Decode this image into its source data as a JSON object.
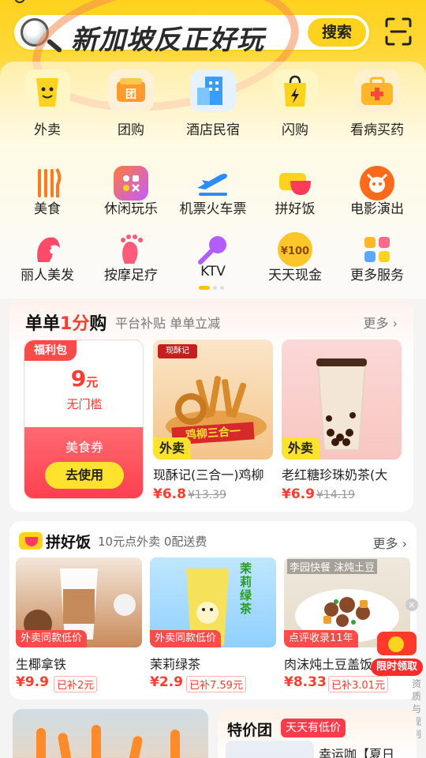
{
  "search": {
    "query": "新加坡反正好玩",
    "button_label": "搜索"
  },
  "categories": [
    {
      "label": "外卖",
      "icon": "takeout-icon"
    },
    {
      "label": "团购",
      "icon": "group-buy-icon"
    },
    {
      "label": "酒店民宿",
      "icon": "hotel-icon"
    },
    {
      "label": "闪购",
      "icon": "flash-buy-icon"
    },
    {
      "label": "看病买药",
      "icon": "medicine-icon"
    },
    {
      "label": "美食",
      "icon": "food-icon"
    },
    {
      "label": "休闲玩乐",
      "icon": "leisure-icon"
    },
    {
      "label": "机票火车票",
      "icon": "plane-icon"
    },
    {
      "label": "拼好饭",
      "icon": "pinhaofan-icon"
    },
    {
      "label": "电影演出",
      "icon": "movie-icon"
    },
    {
      "label": "丽人美发",
      "icon": "beauty-icon"
    },
    {
      "label": "按摩足疗",
      "icon": "massage-icon"
    },
    {
      "label": "KTV",
      "icon": "ktv-icon"
    },
    {
      "label": "天天现金",
      "icon": "cash-icon"
    },
    {
      "label": "更多服务",
      "icon": "more-services-icon"
    }
  ],
  "deals": {
    "title_prefix": "单单",
    "title_highlight": "1分",
    "title_suffix": "购",
    "subtitle": "平台补贴 单单立减",
    "more": "更多",
    "coupon": {
      "tag": "福利包",
      "value": "9",
      "unit": "元",
      "condition": "无门槛",
      "name": "美食券",
      "button": "去使用"
    },
    "products": [
      {
        "badge": "外卖",
        "name": "现酥记(三合一)鸡柳",
        "price": "¥6.8",
        "original": "¥13.39",
        "brand": "现酥记",
        "banner": "鸡柳三合一"
      },
      {
        "badge": "外卖",
        "name": "老红糖珍珠奶茶(大",
        "price": "¥6.9",
        "original": "¥14.19"
      }
    ]
  },
  "pinhaofan": {
    "title": "拼好饭",
    "subtitle": "10元点外卖 0配送费",
    "more": "更多",
    "items": [
      {
        "tag": "外卖同款低价",
        "name": "生椰拿铁",
        "price": "¥9.9",
        "subsidy": "已补2元"
      },
      {
        "tag": "外卖同款低价",
        "name": "茉莉绿茶",
        "price": "¥2.9",
        "subsidy": "已补7.59元",
        "label": "茉莉绿茶"
      },
      {
        "tag": "点评收录11年",
        "name": "肉沫炖土豆盖饭",
        "price": "¥8.33",
        "subsidy": "已补3.01元",
        "store": "李园快餐",
        "store_extra": "沫炖土豆"
      }
    ]
  },
  "floater": {
    "label": "限时领取"
  },
  "side_label": "资质与规则",
  "tejia": {
    "title": "特价团",
    "tag": "天天有低价",
    "item": "幸运咖【夏日"
  }
}
